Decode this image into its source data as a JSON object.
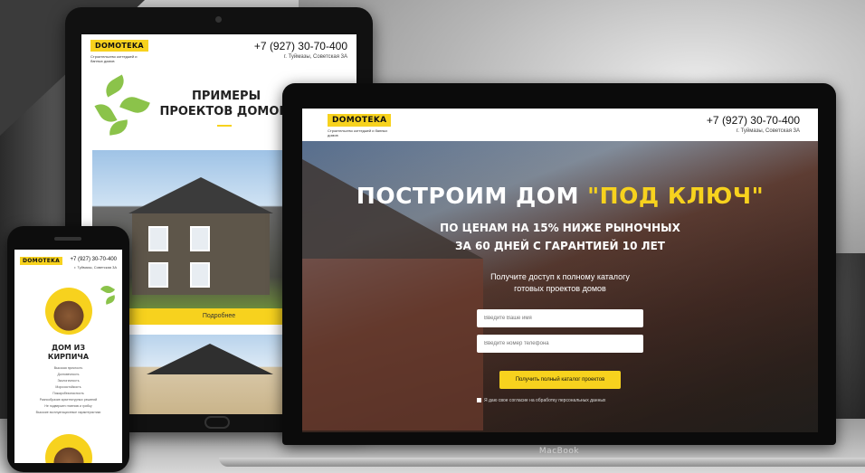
{
  "colors": {
    "accent": "#f7d21e",
    "dark": "#111111"
  },
  "laptop": {
    "brand_label": "MacBook",
    "site": {
      "logo": "DOMOTEKA",
      "tagline": "Строительство коттеджей и банных домов",
      "phone": "+7 (927) 30-70-400",
      "address": "г. Туймазы, Советская 3А",
      "hero_title_main": "ПОСТРОИМ ДОМ ",
      "hero_title_accent": "\"ПОД КЛЮЧ\"",
      "hero_sub_1": "ПО ЦЕНАМ НА 15% НИЖЕ РЫНОЧНЫХ",
      "hero_sub_2": "ЗА 60 ДНЕЙ С ГАРАНТИЕЙ 10 ЛЕТ",
      "promo_1": "Получите доступ к полному каталогу",
      "promo_2": "готовых проектов домов",
      "name_placeholder": "Введите Ваше имя",
      "phone_placeholder": "Введите номер телефона",
      "cta_label": "Получить полный каталог проектов",
      "consent_text": "Я даю свое согласие на обработку персональных данных"
    }
  },
  "tablet": {
    "site": {
      "logo": "DOMOTEKA",
      "tagline": "Строительство коттеджей и банных домов",
      "phone": "+7 (927) 30-70-400",
      "address": "г. Туймазы, Советская 3А",
      "heading_1": "ПРИМЕРЫ",
      "heading_2": "ПРОЕКТОВ ДОМОВ:",
      "more_label": "Подробнее"
    }
  },
  "phone": {
    "site": {
      "logo": "DOMOTEKA",
      "phone": "+7 (927) 30-70-400",
      "address": "г. Туймазы, Советская 3А",
      "title_1": "ДОМ ИЗ",
      "title_2": "КИРПИЧА",
      "features": [
        "Высокая прочность",
        "Долговечность",
        "Экологичность",
        "Морозостойкость",
        "Пожаробезопасность",
        "Разнообразие архитектурных решений",
        "Не подвержен гниению и грибку",
        "Высокие эксплуатационные характеристики"
      ]
    }
  }
}
